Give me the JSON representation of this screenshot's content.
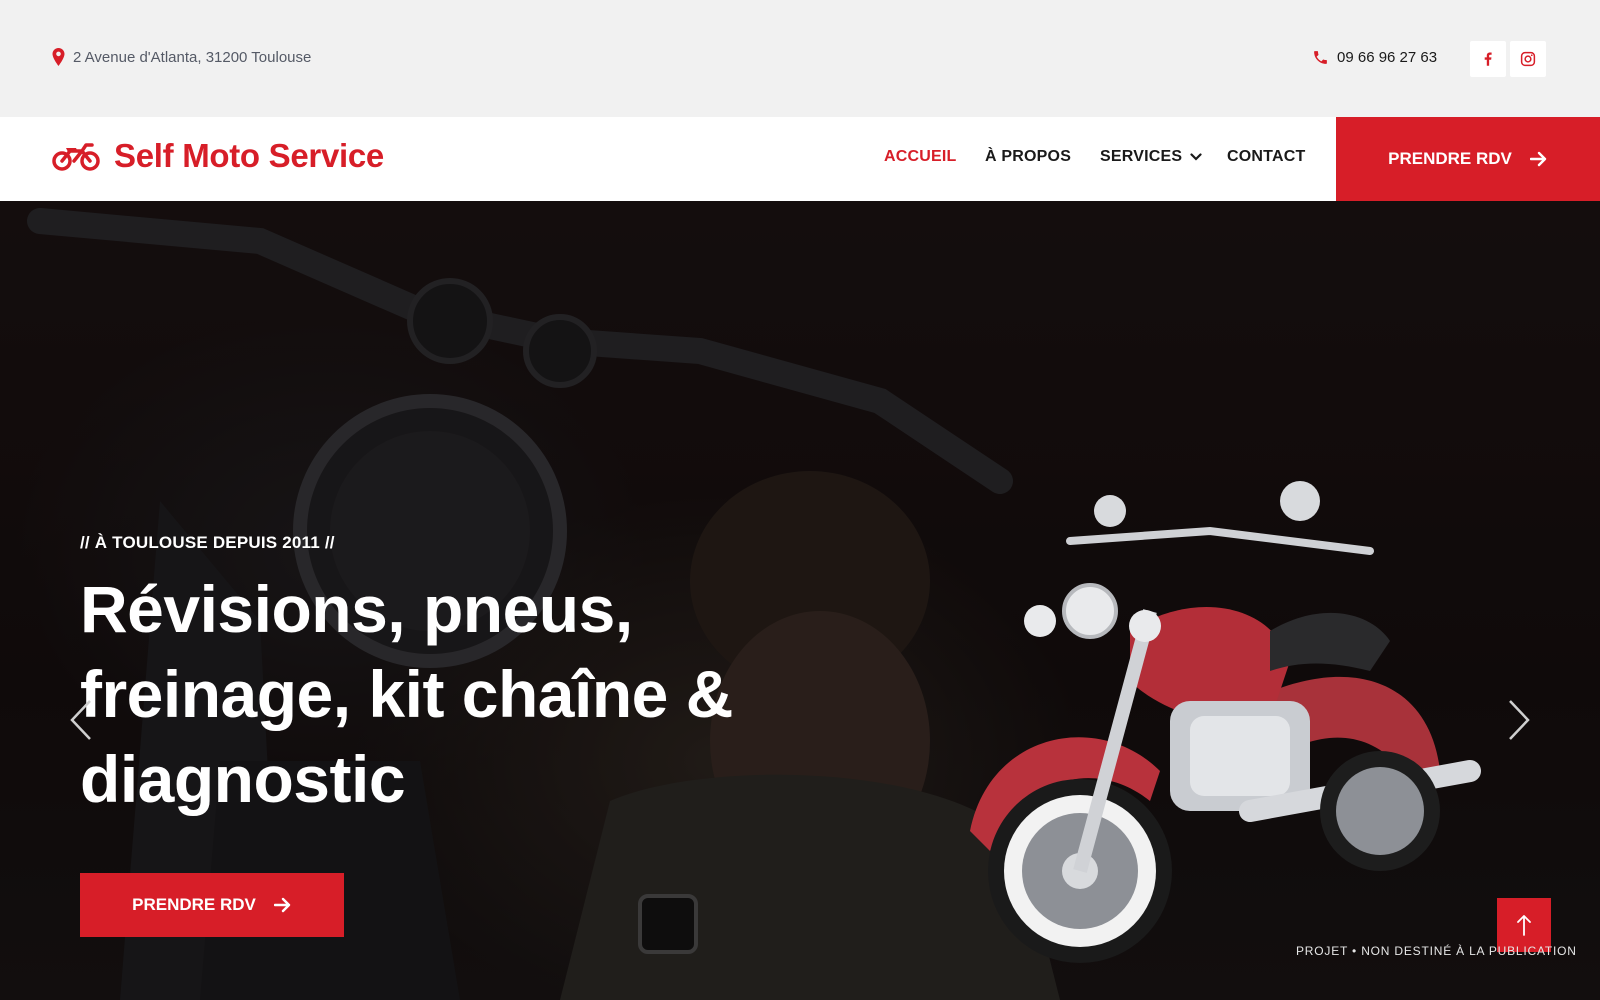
{
  "topbar": {
    "address": "2 Avenue d'Atlanta, 31200 Toulouse",
    "phone": "09 66 96 27 63",
    "icons": {
      "address": "map-pin-icon",
      "phone": "phone-icon",
      "facebook": "facebook-icon",
      "instagram": "instagram-icon"
    }
  },
  "header": {
    "logo_text": "Self Moto Service",
    "logo_icon": "motorcycle-icon",
    "nav": [
      {
        "label": "ACCUEIL",
        "active": true
      },
      {
        "label": "À PROPOS",
        "active": false
      },
      {
        "label": "SERVICES",
        "active": false,
        "has_dropdown": true
      },
      {
        "label": "CONTACT",
        "active": false
      }
    ],
    "cta_label": "PRENDRE RDV"
  },
  "hero": {
    "tagline": "// À TOULOUSE DEPUIS 2011 //",
    "title": "Révisions, pneus, freinage, kit chaîne & diagnostic",
    "cta_label": "PRENDRE RDV",
    "disclaimer": "PROJET • NON DESTINÉ À LA PUBLICATION"
  },
  "colors": {
    "accent": "#d71e28",
    "topbar_bg": "#f1f1f1",
    "header_bg": "#ffffff",
    "hero_bg": "#140e0e",
    "text_dark": "#1a1a1a"
  }
}
